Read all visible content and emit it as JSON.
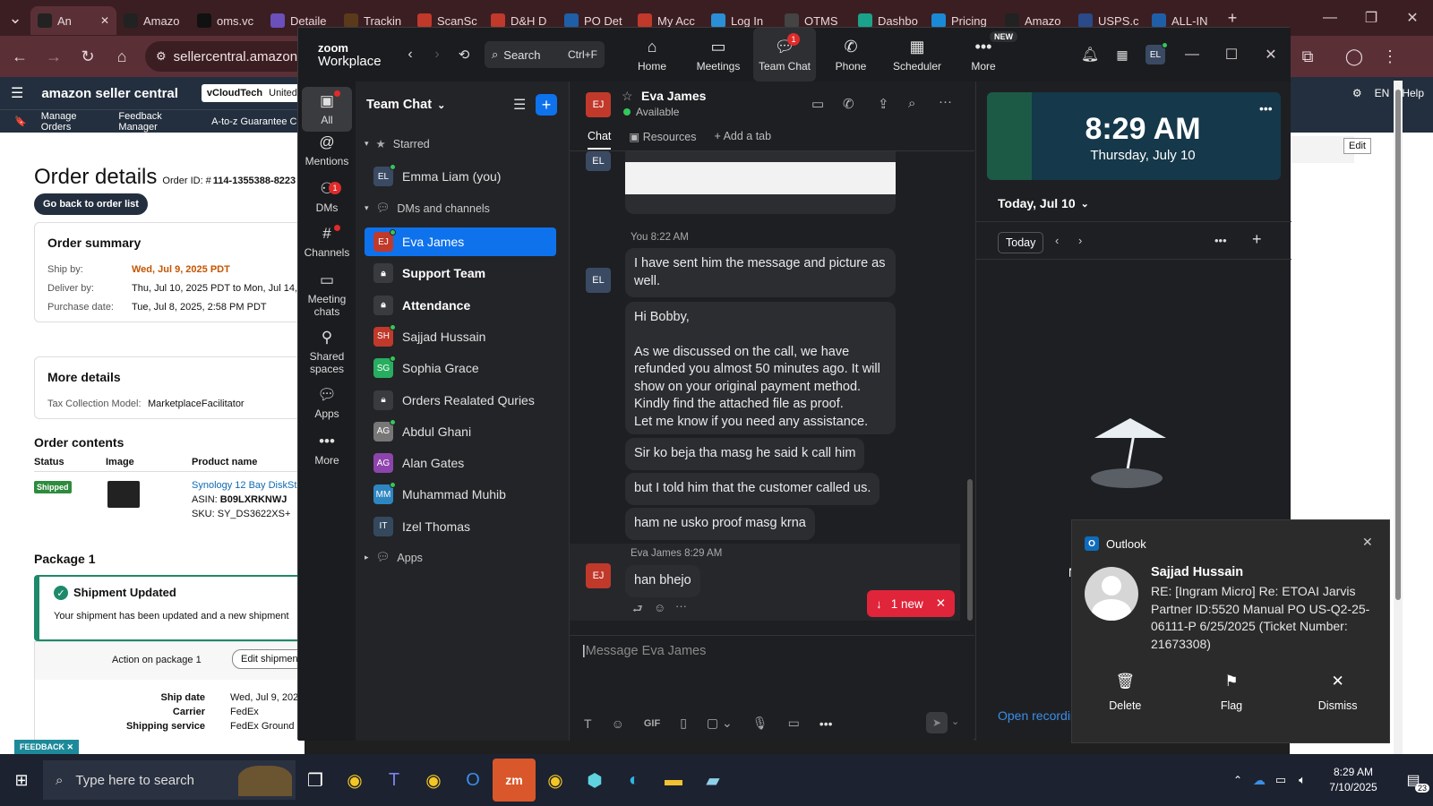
{
  "browser": {
    "tabs": [
      {
        "label": "An",
        "icon": "amazon-icon",
        "color": "#222"
      },
      {
        "label": "Amazo",
        "icon": "amazon-icon",
        "color": "#222"
      },
      {
        "label": "oms.vc",
        "icon": "oms-icon",
        "color": "#111"
      },
      {
        "label": "Detaile",
        "icon": "bars-icon",
        "color": "#6b4fbb"
      },
      {
        "label": "Trackin",
        "icon": "ups-icon",
        "color": "#5a3a1a"
      },
      {
        "label": "ScanSc",
        "icon": "scan-icon",
        "color": "#c0392b"
      },
      {
        "label": "D&H D",
        "icon": "dh-icon",
        "color": "#c0392b"
      },
      {
        "label": "PO Det",
        "icon": "ec-icon",
        "color": "#1f5fa8"
      },
      {
        "label": "My Acc",
        "icon": "myacc-icon",
        "color": "#c0392b"
      },
      {
        "label": "Log In",
        "icon": "login-icon",
        "color": "#2a8fd6"
      },
      {
        "label": "OTMS",
        "icon": "otms-icon",
        "color": "#444"
      },
      {
        "label": "Dashbo",
        "icon": "dash-icon",
        "color": "#1aa38a"
      },
      {
        "label": "Pricing",
        "icon": "pricing-icon",
        "color": "#1a8ad6"
      },
      {
        "label": "Amazo",
        "icon": "amazon-icon",
        "color": "#222"
      },
      {
        "label": "USPS.c",
        "icon": "usps-icon",
        "color": "#2a4a8a"
      },
      {
        "label": "ALL-IN",
        "icon": "allin-icon",
        "color": "#1f5fa8"
      }
    ],
    "url": "sellercentral.amazon.com"
  },
  "amazon": {
    "logo": "amazon seller central",
    "store": "vCloudTech",
    "region": "United Stat",
    "nav": [
      "Manage Orders",
      "Feedback Manager",
      "A-to-z Guarantee Cla"
    ],
    "lang": "EN",
    "help": "Help",
    "edit": "Edit",
    "title": "Order details",
    "order_id_label": "Order ID: #",
    "order_id": "114-1355388-8223",
    "back_button": "Go back to order list",
    "summary": {
      "heading": "Order summary",
      "ship_by_label": "Ship by:",
      "ship_by": "Wed, Jul 9, 2025 PDT",
      "deliver_by_label": "Deliver by:",
      "deliver_by": "Thu, Jul 10, 2025 PDT to Mon, Jul 14,",
      "purchase_label": "Purchase date:",
      "purchase": "Tue, Jul 8, 2025, 2:58 PM PDT"
    },
    "more_details": {
      "heading": "More details",
      "tax_label": "Tax Collection Model:",
      "tax_value": "MarketplaceFacilitator"
    },
    "contents": {
      "heading": "Order contents",
      "columns": [
        "Status",
        "Image",
        "Product name"
      ],
      "status": "Shipped",
      "product": "Synology 12 Bay DiskSt",
      "asin_label": "ASIN:",
      "asin": "B09LXRKNWJ",
      "sku_label": "SKU:",
      "sku": "SY_DS3622XS+"
    },
    "package": {
      "heading": "Package 1",
      "update_title": "Shipment Updated",
      "update_text": "Your shipment has been updated and a new shipment",
      "action_label": "Action on package 1",
      "edit_button": "Edit shipment",
      "ship_date_label": "Ship date",
      "ship_date": "Wed, Jul 9, 202",
      "carrier_label": "Carrier",
      "carrier": "FedEx",
      "service_label": "Shipping service",
      "service": "FedEx Ground"
    },
    "feedback": "FEEDBACK"
  },
  "zoom": {
    "brand_top": "zoom",
    "brand_bottom": "Workplace",
    "search": "Search",
    "search_shortcut": "Ctrl+F",
    "top_tabs": [
      {
        "label": "Home",
        "icon": "home-icon"
      },
      {
        "label": "Meetings",
        "icon": "video-icon"
      },
      {
        "label": "Team Chat",
        "icon": "chat-icon",
        "badge": "1"
      },
      {
        "label": "Phone",
        "icon": "phone-icon"
      },
      {
        "label": "Scheduler",
        "icon": "calendar-icon"
      },
      {
        "label": "More",
        "icon": "more-icon",
        "tag": "NEW"
      }
    ],
    "avatar": "EL",
    "rail": [
      {
        "label": "All",
        "icon": "chat-bubble-icon"
      },
      {
        "label": "Mentions",
        "icon": "at-icon"
      },
      {
        "label": "DMs",
        "icon": "people-icon",
        "badge": "1"
      },
      {
        "label": "Channels",
        "icon": "hash-icon"
      },
      {
        "label": "Meeting chats",
        "icon": "meeting-chat-icon"
      },
      {
        "label": "Shared spaces",
        "icon": "shared-icon"
      },
      {
        "label": "Apps",
        "icon": "apps-icon"
      },
      {
        "label": "More",
        "icon": "ellipsis-icon"
      }
    ],
    "sidebar": {
      "title": "Team Chat",
      "starred": "Starred",
      "starred_items": [
        {
          "name": "Emma Liam (you)",
          "initials": "EL",
          "color": "#3b4a63"
        }
      ],
      "dms_heading": "DMs and channels",
      "items": [
        {
          "name": "Eva James",
          "initials": "EJ",
          "color": "#c0392b",
          "selected": true
        },
        {
          "name": "Support Team",
          "lock": true,
          "bold": true
        },
        {
          "name": "Attendance",
          "lock": true,
          "bold": true
        },
        {
          "name": "Sajjad Hussain",
          "initials": "SH",
          "color": "#c0392b"
        },
        {
          "name": "Sophia Grace",
          "initials": "SG",
          "color": "#27ae60"
        },
        {
          "name": "Orders Realated Quries",
          "lock": true
        },
        {
          "name": "Abdul Ghani",
          "initials": "AG",
          "color": "#777"
        },
        {
          "name": "Alan Gates",
          "initials": "AG",
          "color": "#8e44ad"
        },
        {
          "name": "Muhammad Muhib",
          "initials": "MM",
          "color": "#2e86c1"
        },
        {
          "name": "Izel Thomas",
          "initials": "IT",
          "color": "#34495e"
        }
      ],
      "apps": "Apps"
    },
    "chat": {
      "contact": "Eva James",
      "contact_initials": "EJ",
      "status": "Available",
      "tabs": [
        "Chat",
        "Resources",
        "Add a tab"
      ],
      "me_initials": "EL",
      "meta1": "You 8:22 AM",
      "messages": [
        "I have sent him the message and picture as well.",
        "Hi Bobby,",
        "As we discussed on the call, we have refunded you almost 50 minutes ago. It will show on your original payment method. Kindly find the attached file as proof.",
        "Let me know if you need any assistance.",
        "Sir ko beja tha masg he said k call him",
        "but I told him that the customer called us.",
        "ham ne usko proof masg krna"
      ],
      "meta2": "Eva James 8:29 AM",
      "reply": "han bhejo",
      "new_pill": "1 new",
      "composer_placeholder": "Message Eva James",
      "gif": "GIF"
    },
    "calendar": {
      "time": "8:29 AM",
      "date": "Thursday, July 10",
      "day": "Today, Jul 10",
      "today": "Today",
      "empty": "No meetings scheduled",
      "open_rec": "Open recordin"
    }
  },
  "toast": {
    "app": "Outlook",
    "sender": "Sajjad Hussain",
    "subject": "RE: [Ingram Micro] Re: ETOAI Jarvis Partner ID:5520 Manual PO US-Q2-25-06111-P 6/25/2025 (Ticket Number: 21673308)",
    "actions": [
      "Delete",
      "Flag",
      "Dismiss"
    ]
  },
  "taskbar": {
    "search_placeholder": "Type here to search",
    "time": "8:29 AM",
    "date": "7/10/2025",
    "notif_count": "23"
  }
}
